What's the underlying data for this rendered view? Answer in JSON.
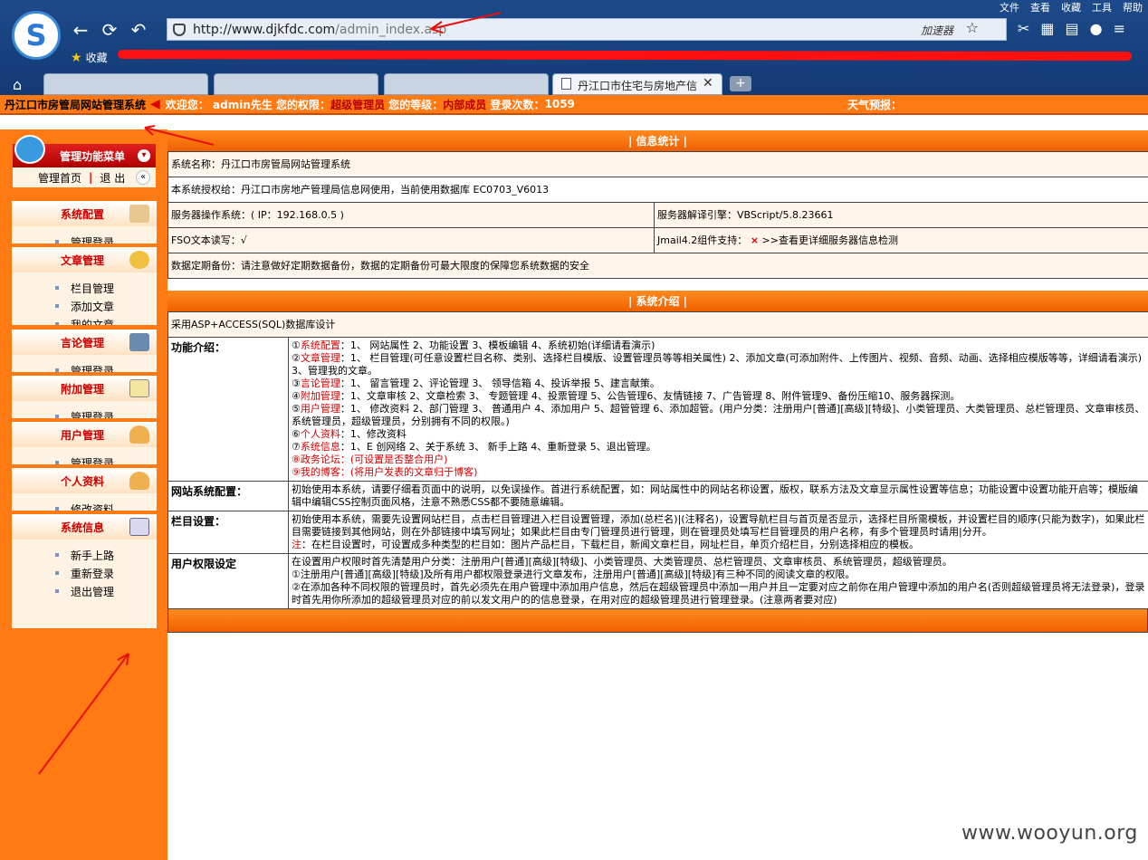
{
  "browser": {
    "menu": [
      "文件",
      "查看",
      "收藏",
      "工具",
      "帮助"
    ],
    "url_host": "http://www.djkfdc.com",
    "url_path": "/admin_index.asp",
    "accelerator": "加速器",
    "favorites": "收藏",
    "active_tab_title": "丹江口市住宅与房地产信"
  },
  "header": {
    "site_title": "丹江口市房管局网站管理系统",
    "welcome": "欢迎您：",
    "user": "admin先生",
    "perm_label": "您的权限：",
    "perm": "超级管理员",
    "level_label": "您的等级：",
    "level": "内部成员",
    "login_label": "登录次数：",
    "login_count": "1059",
    "weather": "天气预报："
  },
  "sidebar": {
    "title": "管理功能菜单",
    "home": "管理首页",
    "logout": "退 出",
    "sections": [
      {
        "title": "系统配置",
        "items": [
          "管理登录"
        ]
      },
      {
        "title": "文章管理",
        "items": [
          "栏目管理",
          "添加文章",
          "我的文章"
        ]
      },
      {
        "title": "言论管理",
        "items": [
          "管理登录"
        ]
      },
      {
        "title": "附加管理",
        "items": [
          "管理登录"
        ]
      },
      {
        "title": "用户管理",
        "items": [
          "管理登录"
        ]
      },
      {
        "title": "个人资料",
        "items": [
          "修改资料"
        ]
      },
      {
        "title": "系统信息",
        "items": [
          "新手上路",
          "重新登录",
          "退出管理"
        ]
      }
    ]
  },
  "info": {
    "title": "| 信息统计 |",
    "system_name": "系统名称：丹江口市房管局网站管理系统",
    "license": "本系统授权给：丹江口市房地产管理局信息网使用，当前使用数据库 EC0703_V6013",
    "os": "服务器操作系统：( IP：192.168.0.5 )",
    "engine": "服务器解译引擎：VBScript/5.8.23661",
    "fso": "FSO文本读写：√",
    "jmail": "Jmail4.2组件支持：",
    "jmail_mark": "×",
    "jmail_link": ">>查看更详细服务器信息检测",
    "backup": "数据定期备份：请注意做好定期数据备份，数据的定期备份可最大限度的保障您系统数据的安全"
  },
  "intro": {
    "title": "| 系统介绍 |",
    "db": "采用ASP+ACCESS(SQL)数据库设计",
    "func_label": "功能介绍：",
    "func_lines": [
      {
        "n": "①",
        "k": "系统配置",
        "v": "：1、 网站属性 2、功能设置 3、模板编辑 4、系统初始(详细请看演示)"
      },
      {
        "n": "②",
        "k": "文章管理",
        "v": "：1、 栏目管理(可任意设置栏目名称、类别、选择栏目模版、设置管理员等等相关属性) 2、添加文章(可添加附件、上传图片、视频、音频、动画、选择相应模版等等，详细请看演示) 3、管理我的文章。"
      },
      {
        "n": "③",
        "k": "言论管理",
        "v": "：1、 留言管理 2、评论管理 3、 领导信箱 4、投诉举报 5、建言献策。"
      },
      {
        "n": "④",
        "k": "附加管理",
        "v": "：1、文章审核 2、文章检索 3、 专题管理 4、投票管理 5、公告管理6、友情链接 7、广告管理 8、附件管理9、备份压缩10、服务器探测。"
      },
      {
        "n": "⑤",
        "k": "用户管理",
        "v": "：1、 修改资料 2、部门管理 3、 普通用户 4、添加用户 5、超管管理 6、添加超管。(用户分类：注册用户[普通][高级][特级]、小类管理员、大类管理员、总栏管理员、文章审核员、系统管理员，超级管理员，分别拥有不同的权限。)"
      },
      {
        "n": "⑥",
        "k": "个人资料",
        "v": "：1、修改资料"
      },
      {
        "n": "⑦",
        "k": "系统信息",
        "v": "：1、E 创网络 2、关于系统 3、 新手上路 4、重新登录 5、退出管理。"
      },
      {
        "n": "⑧",
        "k": "政务论坛",
        "v": "：(可设置是否整合用户)"
      },
      {
        "n": "⑨",
        "k": "我的博客",
        "v": "：(将用户发表的文章归于博客)"
      }
    ],
    "site_cfg_label": "网站系统配置：",
    "site_cfg": "初始使用本系统，请要仔细看页面中的说明，以免误操作。首进行系统配置，如：网站属性中的网站名称设置，版权，联系方法及文章显示属性设置等信息；功能设置中设置功能开启等；模版编辑中编辑CSS控制页面风格，注意不熟悉CSS都不要随意编辑。",
    "col_label": "栏目设置：",
    "col_text": "初始使用本系统，需要先设置网站栏目，点击栏目管理进入栏目设置管理，添加(总栏名)|(注释名)，设置导航栏目与首页是否显示，选择栏目所需模板，并设置栏目的顺序(只能为数字)，如果此栏目需要链接到其他网站，则在外部链接中填写网址；如果此栏目由专门管理员进行管理，则在管理员处填写栏目管理员的用户名称，有多个管理员时请用|分开。",
    "col_note_k": "注",
    "col_note": "：在栏目设置时，可设置成多种类型的栏目如：图片产品栏目，下载栏目，新闻文章栏目，网址栏目，单页介绍栏目，分别选择相应的模板。",
    "perm_label": "用户权限设定",
    "perm_lines": [
      "在设置用户权限时首先清楚用户分类：注册用户[普通][高级][特级]、小类管理员、大类管理员、总栏管理员、文章审核员、系统管理员，超级管理员。",
      "①注册用户[普通][高级][特级]及所有用户都权限登录进行文章发布，注册用户[普通][高级][特级]有三种不同的阅读文章的权限。",
      "②在添加各种不同权限的管理员时，首先必须先在用户管理中添加用户信息，然后在超级管理员中添加一用户并且一定要对应之前你在用户管理中添加的用户名(否则超级管理员将无法登录)，登录时首先用你所添加的超级管理员对应的前以发文用户的的信息登录，在用对应的超级管理员进行管理登录。(注意两者要对应)"
    ]
  },
  "watermark": "www.wooyun.org"
}
